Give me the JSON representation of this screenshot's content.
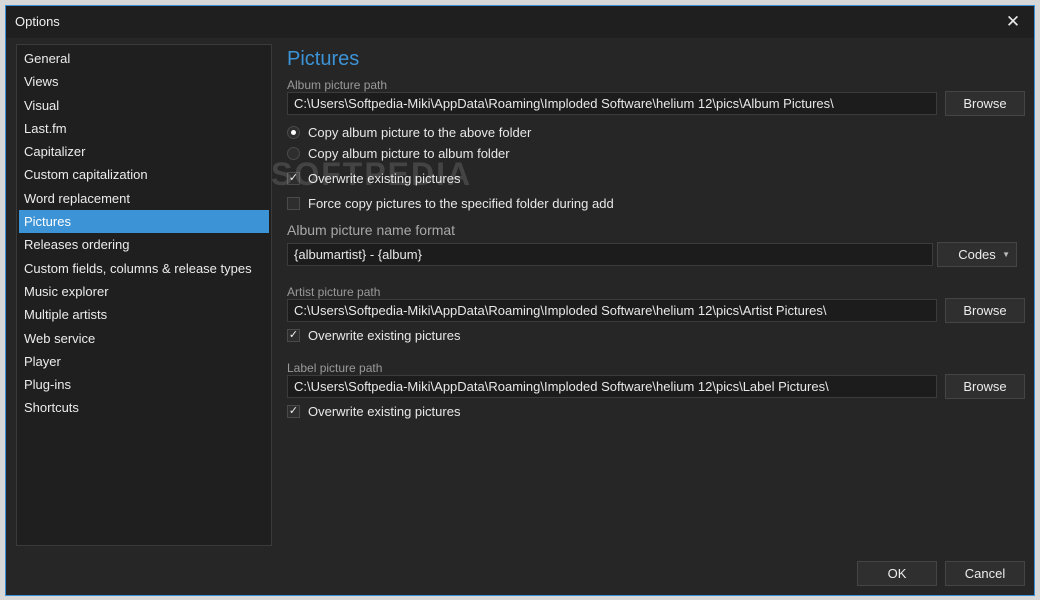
{
  "window": {
    "title": "Options"
  },
  "sidebar": {
    "items": [
      {
        "label": "General"
      },
      {
        "label": "Views"
      },
      {
        "label": "Visual"
      },
      {
        "label": "Last.fm"
      },
      {
        "label": "Capitalizer"
      },
      {
        "label": "Custom capitalization"
      },
      {
        "label": "Word replacement"
      },
      {
        "label": "Pictures"
      },
      {
        "label": "Releases ordering"
      },
      {
        "label": "Custom fields, columns & release types"
      },
      {
        "label": "Music explorer"
      },
      {
        "label": "Multiple artists"
      },
      {
        "label": "Web service"
      },
      {
        "label": "Player"
      },
      {
        "label": "Plug-ins"
      },
      {
        "label": "Shortcuts"
      }
    ],
    "selected": "Pictures"
  },
  "pictures": {
    "heading": "Pictures",
    "album_path_label": "Album picture path",
    "album_path_value": "C:\\Users\\Softpedia-Miki\\AppData\\Roaming\\Imploded Software\\helium 12\\pics\\Album Pictures\\",
    "browse_label": "Browse",
    "radio_above": "Copy album picture to the above folder",
    "radio_album": "Copy album picture to album folder",
    "overwrite_label": "Overwrite existing pictures",
    "force_copy_label": "Force copy pictures to the specified folder during add",
    "name_format_label": "Album picture name format",
    "name_format_value": "{albumartist} - {album}",
    "codes_label": "Codes",
    "artist_path_label": "Artist picture path",
    "artist_path_value": "C:\\Users\\Softpedia-Miki\\AppData\\Roaming\\Imploded Software\\helium 12\\pics\\Artist Pictures\\",
    "label_path_label": "Label picture path",
    "label_path_value": "C:\\Users\\Softpedia-Miki\\AppData\\Roaming\\Imploded Software\\helium 12\\pics\\Label Pictures\\"
  },
  "icons": {
    "close": "close-icon",
    "check": "checkmark-icon",
    "dropdown": "chevron-down-icon"
  },
  "footer": {
    "ok_label": "OK",
    "cancel_label": "Cancel"
  },
  "watermark": "SOFTPEDIA",
  "colors": {
    "accent": "#3c93d6",
    "background": "#262626"
  }
}
